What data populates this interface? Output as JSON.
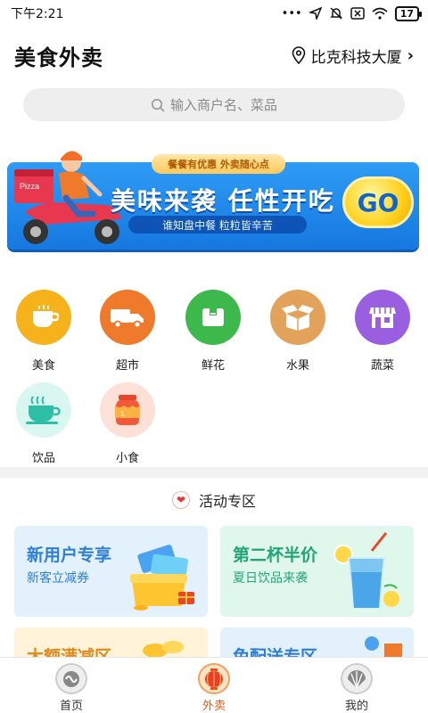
{
  "status_bar": {
    "time": "下午2:21",
    "dots": "•••",
    "battery": "17"
  },
  "header": {
    "title": "美食外卖",
    "location": "比克科技大厦",
    "chevron": "›"
  },
  "search": {
    "placeholder": "输入商户名、菜品",
    "icon": "search-icon"
  },
  "banner": {
    "tag": "餐餐有优惠 外卖随心点",
    "title": "美味来袭 任性开吃",
    "subtitle": "谁知盘中餐 粒粒皆辛苦",
    "go": "GO",
    "box_text": "Pizza"
  },
  "categories": [
    {
      "label": "美食",
      "color": "#f5b21b",
      "icon": "coffee-cup-icon"
    },
    {
      "label": "超市",
      "color": "#f07a2c",
      "icon": "truck-icon"
    },
    {
      "label": "鲜花",
      "color": "#3cb94a",
      "icon": "box-icon"
    },
    {
      "label": "水果",
      "color": "#e3a25a",
      "icon": "open-box-icon"
    },
    {
      "label": "蔬菜",
      "color": "#9a5fe0",
      "icon": "store-icon"
    },
    {
      "label": "饮品",
      "color": "#d9f6f1",
      "icon": "tea-cup-icon"
    },
    {
      "label": "小食",
      "color": "#fde1d6",
      "icon": "jar-icon"
    }
  ],
  "activity": {
    "heading": "活动专区",
    "cards": [
      {
        "title": "新用户专享",
        "subtitle": "新客立减券",
        "bg": "#e3f1fd",
        "color": "#2f7fd6"
      },
      {
        "title": "第二杯半价",
        "subtitle": "夏日饮品来袭",
        "bg": "#e0f7ec",
        "color": "#23a574"
      },
      {
        "title": "大额满减区",
        "subtitle": "",
        "bg": "#fff3d9",
        "color": "#e0891c"
      },
      {
        "title": "免配送专区",
        "subtitle": "",
        "bg": "#e3f1fd",
        "color": "#2f7fd6"
      }
    ]
  },
  "bottom_nav": [
    {
      "label": "首页",
      "active": false
    },
    {
      "label": "外卖",
      "active": true
    },
    {
      "label": "我的",
      "active": false
    }
  ],
  "colors": {
    "accent": "#e05a1f",
    "banner_blue": "#1e88e5"
  }
}
